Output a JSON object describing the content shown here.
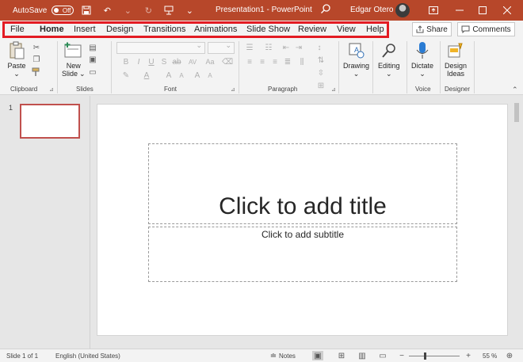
{
  "window": {
    "title": "Presentation1  -  PowerPoint",
    "user": "Edgar Otero",
    "accent_color": "#b7472a",
    "autosave_label": "AutoSave",
    "autosave_state": "Off"
  },
  "quick_access": [
    "save-icon",
    "undo-icon",
    "redo-icon",
    "start-from-beginning-icon",
    "customize-icon"
  ],
  "tabs": [
    {
      "label": "File",
      "active": false
    },
    {
      "label": "Home",
      "active": true
    },
    {
      "label": "Insert",
      "active": false
    },
    {
      "label": "Design",
      "active": false
    },
    {
      "label": "Transitions",
      "active": false
    },
    {
      "label": "Animations",
      "active": false
    },
    {
      "label": "Slide Show",
      "active": false
    },
    {
      "label": "Review",
      "active": false
    },
    {
      "label": "View",
      "active": false
    },
    {
      "label": "Help",
      "active": false
    }
  ],
  "share_label": "Share",
  "comments_label": "Comments",
  "ribbon": {
    "clipboard": {
      "label": "Clipboard",
      "paste": "Paste"
    },
    "slides": {
      "label": "Slides",
      "new_slide_line1": "New",
      "new_slide_line2": "Slide"
    },
    "font": {
      "label": "Font",
      "bold": "B",
      "italic": "I",
      "underline": "U",
      "strike": "S",
      "abc": "ab",
      "av": "AV",
      "aa": "Aa"
    },
    "paragraph": {
      "label": "Paragraph"
    },
    "drawing": {
      "label": "Drawing"
    },
    "editing": {
      "label": "Editing"
    },
    "voice": {
      "label": "Voice",
      "dictate": "Dictate"
    },
    "designer": {
      "label": "Designer",
      "design_ideas_line1": "Design",
      "design_ideas_line2": "Ideas"
    }
  },
  "thumbnail": {
    "number": "1"
  },
  "slide": {
    "title_placeholder": "Click to add title",
    "subtitle_placeholder": "Click to add subtitle"
  },
  "status": {
    "slide_info": "Slide 1 of 1",
    "language": "English (United States)",
    "notes_label": "Notes",
    "zoom_percent": "55 %"
  }
}
